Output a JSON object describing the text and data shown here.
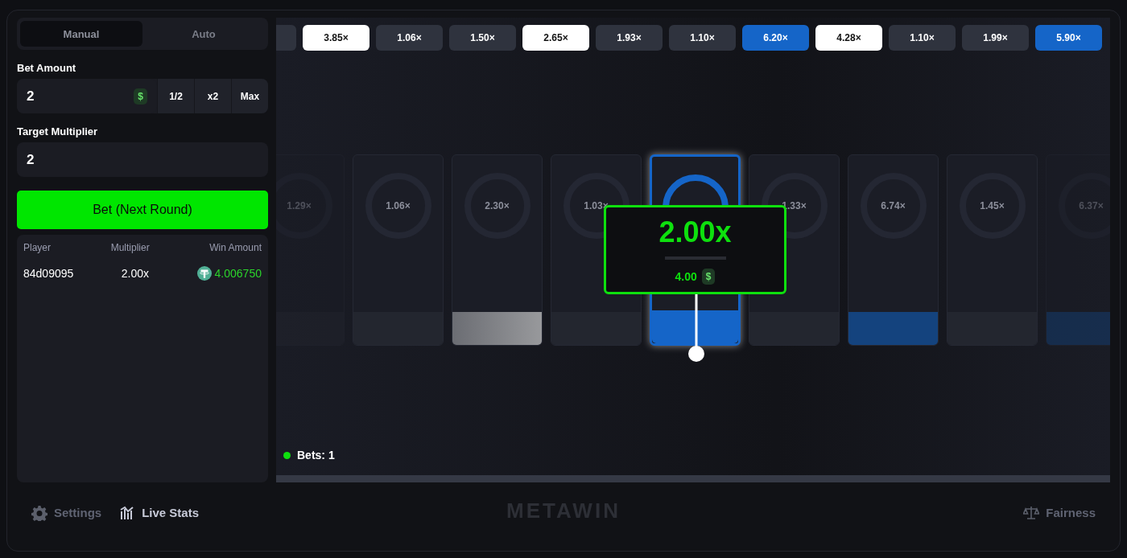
{
  "mode_tabs": [
    {
      "label": "Manual",
      "selected": true
    },
    {
      "label": "Auto",
      "selected": false
    }
  ],
  "bet_amount": {
    "label": "Bet Amount",
    "value": "2",
    "currency": "$",
    "buttons": [
      "1/2",
      "x2",
      "Max"
    ]
  },
  "target_multiplier": {
    "label": "Target Multiplier",
    "value": "2"
  },
  "bet_button": "Bet (Next Round)",
  "bets_table": {
    "columns": [
      "Player",
      "Multiplier",
      "Win Amount"
    ],
    "rows": [
      {
        "player": "84d09095",
        "multiplier": "2.00x",
        "win": "4.006750"
      }
    ]
  },
  "history": [
    {
      "label": "3.85×",
      "kind": "white"
    },
    {
      "label": "1.06×",
      "kind": "dark"
    },
    {
      "label": "1.50×",
      "kind": "dark"
    },
    {
      "label": "2.65×",
      "kind": "white"
    },
    {
      "label": "1.93×",
      "kind": "dark"
    },
    {
      "label": "1.10×",
      "kind": "dark"
    },
    {
      "label": "6.20×",
      "kind": "blue"
    },
    {
      "label": "4.28×",
      "kind": "white"
    },
    {
      "label": "1.10×",
      "kind": "dark"
    },
    {
      "label": "1.99×",
      "kind": "dark"
    },
    {
      "label": "5.90×",
      "kind": "blue"
    }
  ],
  "cards": [
    {
      "label": "1.29×",
      "kind": "plain",
      "faded": true,
      "selected": false
    },
    {
      "label": "1.06×",
      "kind": "plain",
      "faded": false,
      "selected": false
    },
    {
      "label": "2.30×",
      "kind": "gray",
      "faded": false,
      "selected": false
    },
    {
      "label": "1.03×",
      "kind": "plain",
      "faded": false,
      "selected": false
    },
    {
      "kind": "blue",
      "faded": false,
      "selected": true
    },
    {
      "label": "1.33×",
      "kind": "plain",
      "faded": false,
      "selected": false
    },
    {
      "label": "6.74×",
      "kind": "blue",
      "faded": false,
      "selected": false
    },
    {
      "label": "1.45×",
      "kind": "plain",
      "faded": false,
      "selected": false
    },
    {
      "label": "6.37×",
      "kind": "blue",
      "faded": true,
      "selected": false
    }
  ],
  "result_popup": {
    "multiplier": "2.00x",
    "win": "4.00",
    "currency": "$"
  },
  "bets_count": "Bets: 1",
  "footer": {
    "settings": "Settings",
    "live_stats": "Live Stats",
    "logo": "METAWIN",
    "fairness": "Fairness"
  }
}
